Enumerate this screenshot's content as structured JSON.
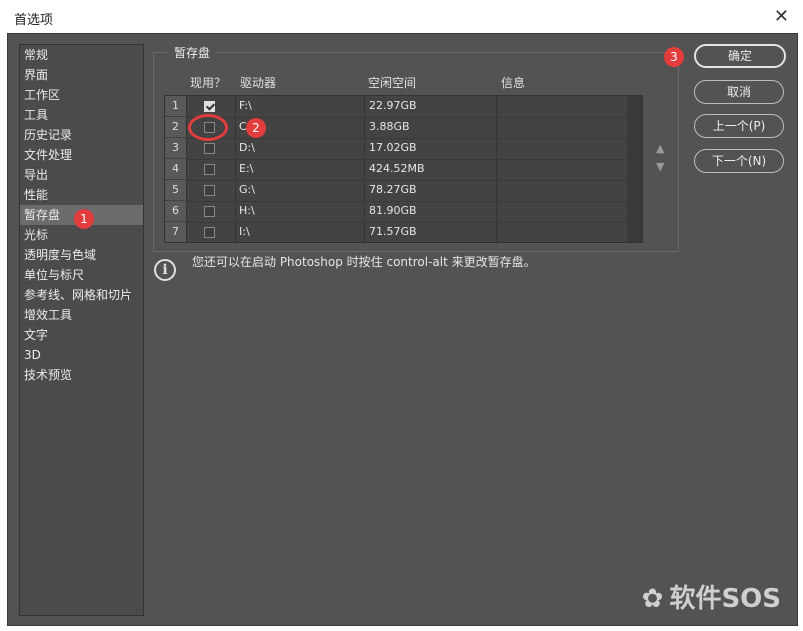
{
  "window": {
    "title": "首选项"
  },
  "sidebar": {
    "items": [
      {
        "label": "常规"
      },
      {
        "label": "界面"
      },
      {
        "label": "工作区"
      },
      {
        "label": "工具"
      },
      {
        "label": "历史记录"
      },
      {
        "label": "文件处理"
      },
      {
        "label": "导出"
      },
      {
        "label": "性能"
      },
      {
        "label": "暂存盘"
      },
      {
        "label": "光标"
      },
      {
        "label": "透明度与色域"
      },
      {
        "label": "单位与标尺"
      },
      {
        "label": "参考线、网格和切片"
      },
      {
        "label": "增效工具"
      },
      {
        "label": "文字"
      },
      {
        "label": "3D"
      },
      {
        "label": "技术预览"
      }
    ],
    "active_index": 8
  },
  "scratch": {
    "legend": "暂存盘",
    "headers": {
      "active": "现用？",
      "drive": "驱动器",
      "free": "空闲空间",
      "info": "信息"
    },
    "rows": [
      {
        "num": "1",
        "checked": true,
        "drive": "F:\\",
        "free": "22.97GB"
      },
      {
        "num": "2",
        "checked": false,
        "drive": "C:\\",
        "free": "3.88GB"
      },
      {
        "num": "3",
        "checked": false,
        "drive": "D:\\",
        "free": "17.02GB"
      },
      {
        "num": "4",
        "checked": false,
        "drive": "E:\\",
        "free": "424.52MB"
      },
      {
        "num": "5",
        "checked": false,
        "drive": "G:\\",
        "free": "78.27GB"
      },
      {
        "num": "6",
        "checked": false,
        "drive": "H:\\",
        "free": "81.90GB"
      },
      {
        "num": "7",
        "checked": false,
        "drive": "I:\\",
        "free": "71.57GB"
      }
    ],
    "info_text": "您还可以在启动 Photoshop 时按住 control-alt 来更改暂存盘。"
  },
  "buttons": {
    "ok": "确定",
    "cancel": "取消",
    "prev": "上一个(P)",
    "next": "下一个(N)"
  },
  "annotations": {
    "b1": "1",
    "b2": "2",
    "b3": "3"
  },
  "watermark": {
    "logo": "✿",
    "text": "软件SOS"
  },
  "icons": {
    "close": "close-icon",
    "info": "info-icon",
    "up": "arrow-up-icon",
    "down": "arrow-down-icon"
  }
}
